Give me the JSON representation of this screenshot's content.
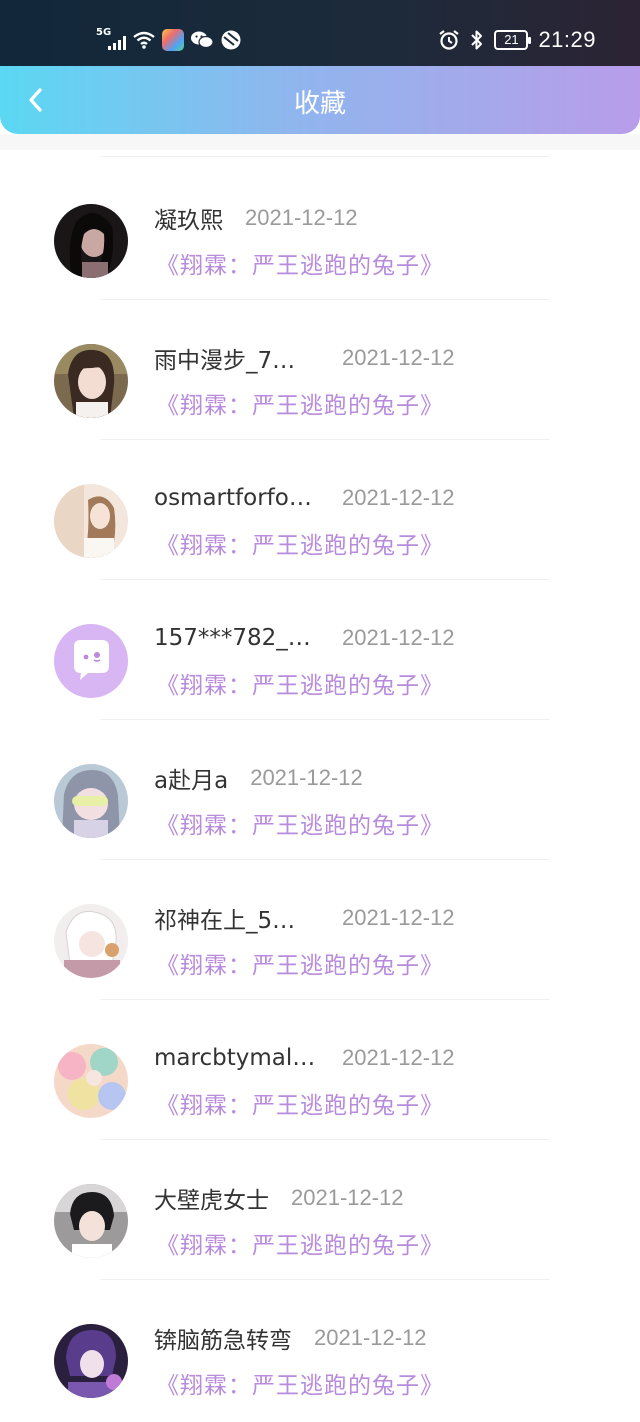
{
  "status_bar": {
    "network": "5G",
    "battery": "21",
    "time": "21:29",
    "icons": [
      "signal-icon",
      "wifi-icon",
      "app-icon",
      "wechat-icon",
      "browser-icon",
      "alarm-icon",
      "bluetooth-icon",
      "battery-icon"
    ]
  },
  "header": {
    "title": "收藏",
    "back_icon": "chevron-left-icon",
    "gradient": [
      "#5bd8f3",
      "#b89dea"
    ]
  },
  "accent_color": "#b98bdc",
  "items": [
    {
      "name": "凝玖熙",
      "date": "2021-12-12",
      "book": "《翔霖：严王逃跑的兔子》",
      "avatar": "dark-portrait"
    },
    {
      "name": "雨中漫步_7…",
      "date": "2021-12-12",
      "book": "《翔霖：严王逃跑的兔子》",
      "avatar": "girl-portrait"
    },
    {
      "name": "osmartforfo…",
      "date": "2021-12-12",
      "book": "《翔霖：严王逃跑的兔子》",
      "avatar": "girl-light-portrait"
    },
    {
      "name": "157***782_…",
      "date": "2021-12-12",
      "book": "《翔霖：严王逃跑的兔子》",
      "avatar": "default-chat-avatar"
    },
    {
      "name": "a赴月a",
      "date": "2021-12-12",
      "book": "《翔霖：严王逃跑的兔子》",
      "avatar": "anime-girl"
    },
    {
      "name": "祁神在上_5…",
      "date": "2021-12-12",
      "book": "《翔霖：严王逃跑的兔子》",
      "avatar": "anime-white-hair"
    },
    {
      "name": "marcbtymal…",
      "date": "2021-12-12",
      "book": "《翔霖：严王逃跑的兔子》",
      "avatar": "colorful-group"
    },
    {
      "name": "大壁虎女士",
      "date": "2021-12-12",
      "book": "《翔霖：严王逃跑的兔子》",
      "avatar": "boy-portrait"
    },
    {
      "name": "锛脑筋急转弯",
      "date": "2021-12-12",
      "book": "《翔霖：严王逃跑的兔子》",
      "avatar": "purple-anime-boy"
    }
  ]
}
